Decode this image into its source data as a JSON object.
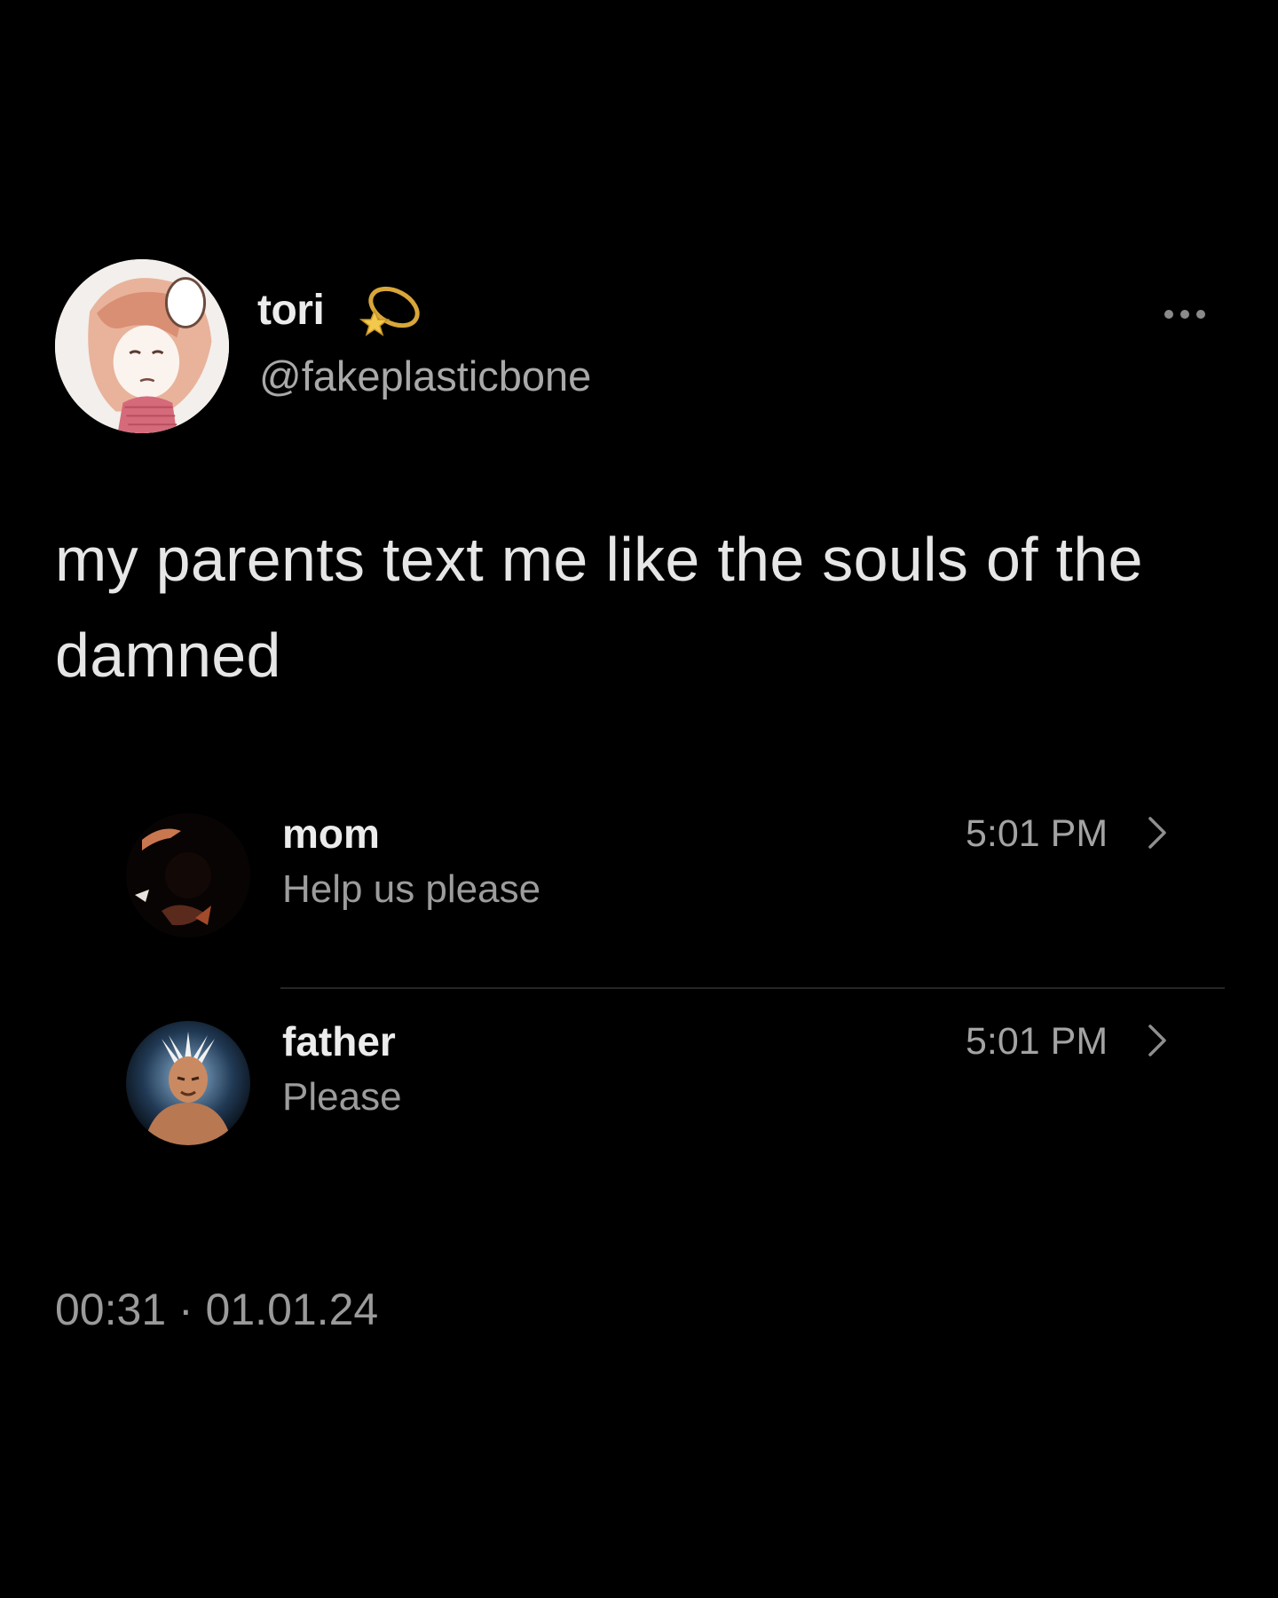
{
  "author": {
    "display_name": "tori",
    "handle": "@fakeplasticbone",
    "avatar": "anime-character-avatar",
    "badge": "dizzy-star-emoji"
  },
  "more_icon": "ellipsis-icon",
  "tweet": {
    "text": "my parents text me like the souls of the damned"
  },
  "messages": [
    {
      "name": "mom",
      "preview": "Help us please",
      "time": "5:01 PM",
      "avatar": "dark-fiery-avatar"
    },
    {
      "name": "father",
      "preview": "Please",
      "time": "5:01 PM",
      "avatar": "bald-man-white-hair-avatar"
    }
  ],
  "footer": {
    "timestamp": "00:31 · 01.01.24"
  },
  "colors": {
    "background": "#000000",
    "primary_text": "#e9e9e9",
    "secondary_text": "#9c9c9c",
    "badge_gold": "#d8a63a"
  }
}
